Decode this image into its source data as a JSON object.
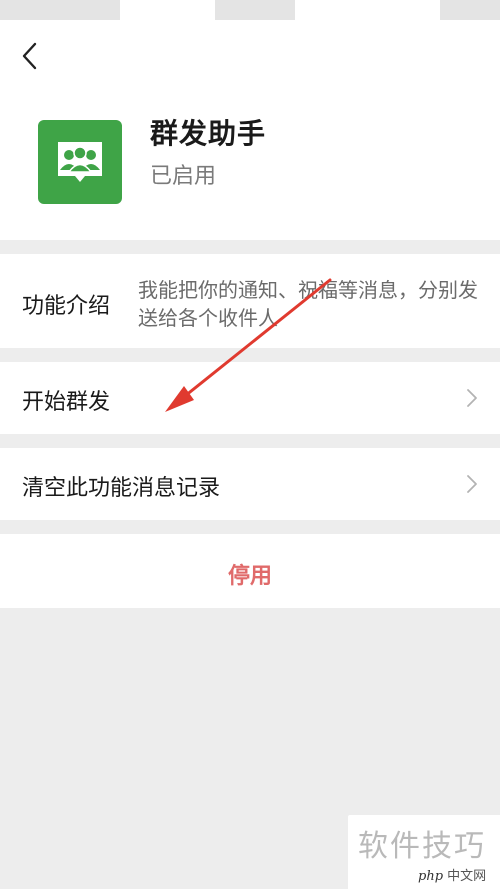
{
  "header": {
    "app_name": "群发助手",
    "app_status": "已启用"
  },
  "intro": {
    "label": "功能介绍",
    "text": "我能把你的通知、祝福等消息，分别发送给各个收件人"
  },
  "menu": {
    "start_label": "开始群发",
    "clear_label": "清空此功能消息记录"
  },
  "actions": {
    "disable_label": "停用"
  },
  "watermark": {
    "text": "软件技巧",
    "logo_php": "php",
    "logo_site": "中文网"
  },
  "colors": {
    "accent_green": "#3fa447",
    "danger_red": "#e06a6a",
    "arrow_red": "#e03a2f"
  }
}
